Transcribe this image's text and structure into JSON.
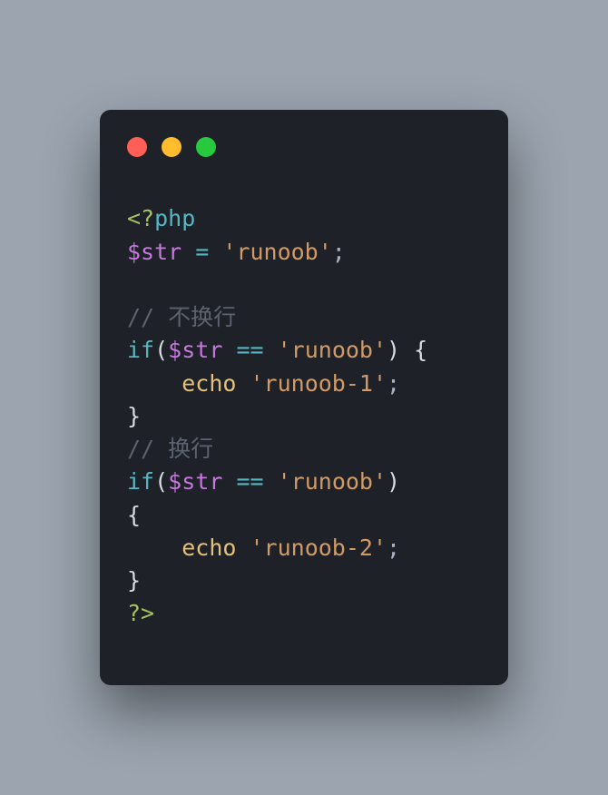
{
  "code": {
    "open_tag_lt": "<?",
    "open_tag_php": "php",
    "var_str": "$str",
    "assign": " = ",
    "str_runoob": "'runoob'",
    "semicolon": ";",
    "blank": "",
    "comment1": "// 不换行",
    "if": "if",
    "lparen": "(",
    "eqeq": " == ",
    "rparen": ")",
    "space": " ",
    "lbrace": "{",
    "indent": "    ",
    "echo": "echo",
    "echo_sp": " ",
    "str_runoob1": "'runoob-1'",
    "rbrace": "}",
    "comment2": "// 换行",
    "str_runoob2": "'runoob-2'",
    "close_tag": "?>"
  }
}
